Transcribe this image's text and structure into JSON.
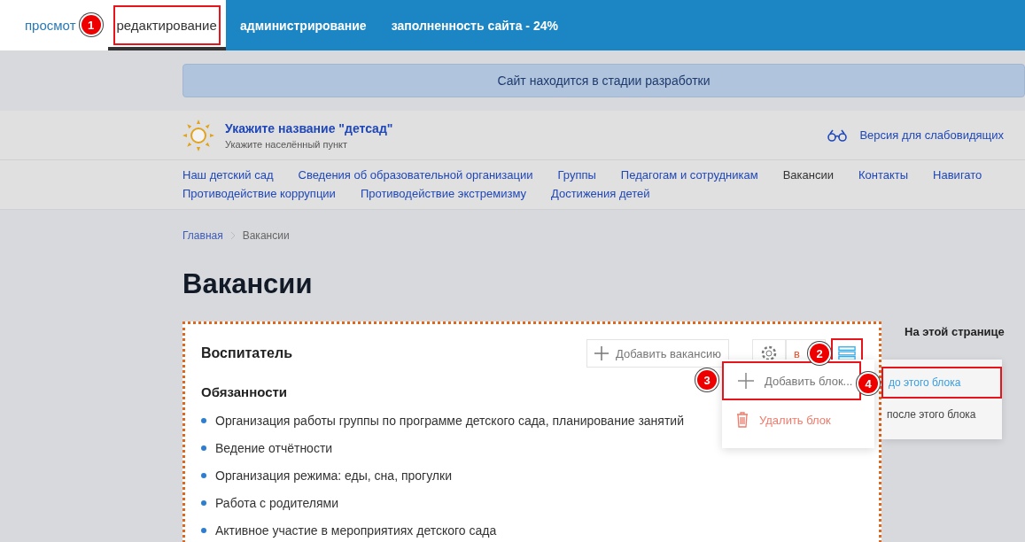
{
  "mode_tabs": [
    {
      "label": "просмот",
      "selected": false
    },
    {
      "label": "редактирование",
      "selected": true,
      "marker": "1"
    }
  ],
  "admin_links": [
    "администрирование",
    "заполненность сайта - 24%"
  ],
  "banner": "Сайт находится в стадии разработки",
  "site": {
    "name": "Укажите название \"детсад\"",
    "locality": "Укажите населённый пункт"
  },
  "accessibility_link": "Версия для слабовидящих",
  "nav": [
    {
      "label": "Наш детский сад",
      "selected": false
    },
    {
      "label": "Сведения об образовательной организации",
      "selected": false
    },
    {
      "label": "Группы",
      "selected": false
    },
    {
      "label": "Педагогам и сотрудникам",
      "selected": false
    },
    {
      "label": "Вакансии",
      "selected": true
    },
    {
      "label": "Контакты",
      "selected": false
    },
    {
      "label": "Навигато",
      "selected": false
    },
    {
      "label": "Противодействие коррупции",
      "selected": false
    },
    {
      "label": "Противодействие экстремизму",
      "selected": false
    },
    {
      "label": "Достижения детей",
      "selected": false
    }
  ],
  "breadcrumbs": [
    "Главная",
    "Вакансии"
  ],
  "page_title": "Вакансии",
  "block": {
    "title": "Воспитатель",
    "add_button": "Добавить вакансию",
    "partial_button": "в",
    "menu_marker": "2",
    "section_title": "Обязанности",
    "items": [
      "Организация работы группы по программе детского сада, планирование занятий",
      "Ведение отчётности",
      "Организация режима: еды, сна, прогулки",
      "Работа с родителями",
      "Активное участие в мероприятиях детского сада"
    ]
  },
  "block_menu": [
    {
      "label": "Добавить блок...",
      "kind": "add",
      "marker": "3"
    },
    {
      "label": "Удалить блок",
      "kind": "delete"
    }
  ],
  "submenu": [
    {
      "label": "до этого блока",
      "selected": true,
      "marker": "4"
    },
    {
      "label": "после этого блока",
      "selected": false
    }
  ],
  "sidebar_title": "На этой странице"
}
